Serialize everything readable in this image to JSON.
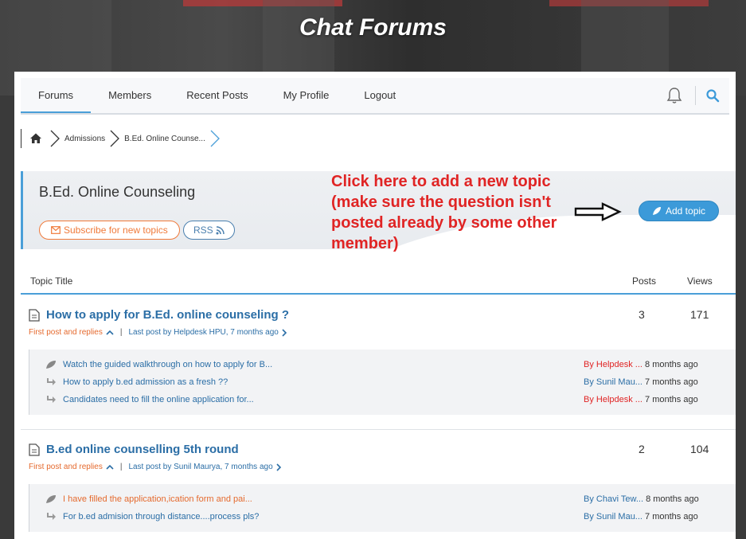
{
  "hero": {
    "title": "Chat Forums"
  },
  "nav": {
    "items": [
      "Forums",
      "Members",
      "Recent Posts",
      "My Profile",
      "Logout"
    ],
    "active": "Forums"
  },
  "breadcrumb": {
    "items": [
      "Admissions",
      "B.Ed. Online Counse..."
    ]
  },
  "forum": {
    "title": "B.Ed. Online Counseling",
    "subscribe_label": "Subscribe for new topics",
    "rss_label": "RSS",
    "add_topic_label": "Add topic"
  },
  "annotation": {
    "text": "Click here to add a new topic (make sure the question isn't posted already by some other member)"
  },
  "list_header": {
    "title": "Topic Title",
    "posts": "Posts",
    "views": "Views"
  },
  "topics": [
    {
      "title": "How to apply for B.Ed. online counseling ?",
      "posts": "3",
      "views": "171",
      "first_post": "First post and replies",
      "last_post": "Last post by Helpdesk HPU, 7 months ago",
      "replies": [
        {
          "icon": "leaf-icon",
          "text": "Watch the guided walkthrough on how to apply for B...",
          "by": "By Helpdesk ...",
          "ago": "8 months ago",
          "by_color": "red"
        },
        {
          "icon": "reply-arrow-icon",
          "text": "How to apply b.ed admission as a fresh ??",
          "by": "By Sunil Mau...",
          "ago": "7 months ago",
          "by_color": "blue"
        },
        {
          "icon": "reply-arrow-icon",
          "text": "Candidates need to fill the online application for...",
          "by": "By Helpdesk ...",
          "ago": "7 months ago",
          "by_color": "red"
        }
      ]
    },
    {
      "title": "B.ed online counselling 5th round",
      "posts": "2",
      "views": "104",
      "first_post": "First post and replies",
      "last_post": "Last post by Sunil Maurya, 7 months ago",
      "replies": [
        {
          "icon": "leaf-icon",
          "text": "I have filled the application,ication form and pai...",
          "by": "By Chavi Tew...",
          "ago": "8 months ago",
          "by_color": "blue"
        },
        {
          "icon": "reply-arrow-icon",
          "text": "For b.ed admision through distance....process pls?",
          "by": "By Sunil Mau...",
          "ago": "7 months ago",
          "by_color": "blue"
        }
      ]
    }
  ],
  "colors": {
    "accent": "#4a9fd8",
    "orange": "#e56a2e",
    "annotation_red": "#e02424",
    "link_blue": "#2b6ea6"
  }
}
